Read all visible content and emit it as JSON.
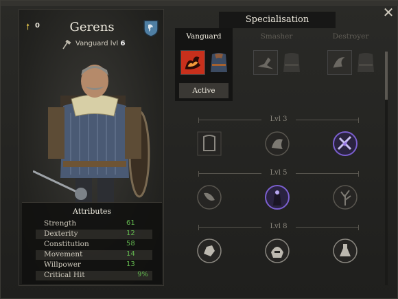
{
  "character": {
    "name": "Gerens",
    "points": "0",
    "class_name": "Vanguard lvl",
    "class_level": "6"
  },
  "attributes": {
    "title": "Attributes",
    "rows": [
      {
        "name": "Strength",
        "value": "61"
      },
      {
        "name": "Dexterity",
        "value": "12"
      },
      {
        "name": "Constitution",
        "value": "58"
      },
      {
        "name": "Movement",
        "value": "14"
      },
      {
        "name": "Willpower",
        "value": "13"
      },
      {
        "name": "Critical Hit",
        "value": "9%"
      }
    ]
  },
  "specialisation": {
    "title": "Specialisation",
    "tabs": [
      {
        "label": "Vanguard",
        "active": true,
        "button": "Active"
      },
      {
        "label": "Smasher",
        "active": false
      },
      {
        "label": "Destroyer",
        "active": false
      }
    ],
    "tiers": [
      {
        "label": "Lvl 3",
        "perks": [
          "shield-perk-icon",
          "armor-perk-icon",
          "lightning-perk-icon"
        ]
      },
      {
        "label": "Lvl 5",
        "perks": [
          "horn-perk-icon",
          "aura-perk-icon",
          "tree-perk-icon"
        ]
      },
      {
        "label": "Lvl 8",
        "perks": [
          "fist-perk-icon",
          "helm-perk-icon",
          "flask-perk-icon"
        ]
      }
    ]
  },
  "colors": {
    "attribute_value": "#63b74f",
    "accent_gold": "#e6c74b",
    "active_skill": "#c8301c",
    "highlight_perk": "#7b5fd0"
  }
}
